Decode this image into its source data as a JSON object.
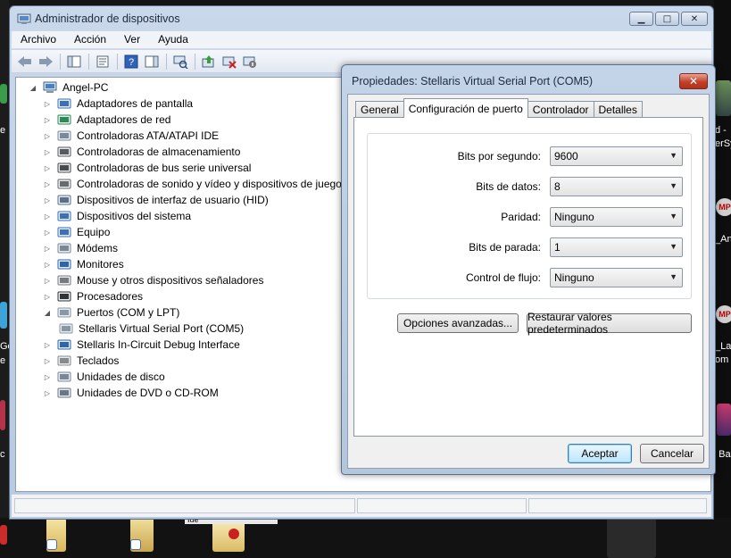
{
  "main_window": {
    "title": "Administrador de dispositivos",
    "caption_buttons": {
      "minimize": "▁",
      "maximize": "□",
      "close": "✕"
    },
    "menu": [
      "Archivo",
      "Acción",
      "Ver",
      "Ayuda"
    ],
    "tree": {
      "root": "Angel-PC",
      "items": [
        {
          "label": "Adaptadores de pantalla",
          "icon": "display-adapter-icon",
          "expander": "▷"
        },
        {
          "label": "Adaptadores de red",
          "icon": "network-adapter-icon",
          "expander": "▷"
        },
        {
          "label": "Controladoras ATA/ATAPI IDE",
          "icon": "ide-controller-icon",
          "expander": "▷"
        },
        {
          "label": "Controladoras de almacenamiento",
          "icon": "storage-controller-icon",
          "expander": "▷"
        },
        {
          "label": "Controladoras de bus serie universal",
          "icon": "usb-icon",
          "expander": "▷"
        },
        {
          "label": "Controladoras de sonido y vídeo y dispositivos de juego",
          "icon": "sound-icon",
          "expander": "▷"
        },
        {
          "label": "Dispositivos de interfaz de usuario (HID)",
          "icon": "hid-icon",
          "expander": "▷"
        },
        {
          "label": "Dispositivos del sistema",
          "icon": "system-device-icon",
          "expander": "▷"
        },
        {
          "label": "Equipo",
          "icon": "computer-icon",
          "expander": "▷"
        },
        {
          "label": "Módems",
          "icon": "modem-icon",
          "expander": "▷"
        },
        {
          "label": "Monitores",
          "icon": "monitor-icon",
          "expander": "▷"
        },
        {
          "label": "Mouse y otros dispositivos señaladores",
          "icon": "mouse-icon",
          "expander": "▷"
        },
        {
          "label": "Procesadores",
          "icon": "processor-icon",
          "expander": "▷"
        },
        {
          "label": "Puertos (COM y LPT)",
          "icon": "port-icon",
          "expander": "◢"
        },
        {
          "label": "Stellaris Virtual Serial Port (COM5)",
          "icon": "port-icon",
          "expander": ""
        },
        {
          "label": "Stellaris In-Circuit Debug Interface",
          "icon": "debug-interface-icon",
          "expander": "▷"
        },
        {
          "label": "Teclados",
          "icon": "keyboard-icon",
          "expander": "▷"
        },
        {
          "label": "Unidades de disco",
          "icon": "disk-drive-icon",
          "expander": "▷"
        },
        {
          "label": "Unidades de DVD o CD-ROM",
          "icon": "dvd-drive-icon",
          "expander": "▷"
        }
      ]
    }
  },
  "dialog": {
    "title": "Propiedades: Stellaris Virtual Serial Port (COM5)",
    "close_glyph": "✕",
    "tabs": [
      "General",
      "Configuración de puerto",
      "Controlador",
      "Detalles"
    ],
    "active_tab": "Configuración de puerto",
    "fields": [
      {
        "label": "Bits por segundo:",
        "value": "9600"
      },
      {
        "label": "Bits de datos:",
        "value": "8"
      },
      {
        "label": "Paridad:",
        "value": "Ninguno"
      },
      {
        "label": "Bits de parada:",
        "value": "1"
      },
      {
        "label": "Control de flujo:",
        "value": "Ninguno"
      }
    ],
    "buttons": {
      "advanced": "Opciones avanzadas...",
      "restore": "Restaurar valores predeterminados",
      "ok": "Aceptar",
      "cancel": "Cancelar"
    }
  },
  "desktop": {
    "right_labels": [
      "d -",
      "erSy",
      "_An",
      "_La",
      "om",
      "; Ba"
    ],
    "left_labels": [
      "e",
      "Ge",
      "e",
      "c"
    ],
    "mp_badge": "MP",
    "taskbar_text": "Ide"
  }
}
